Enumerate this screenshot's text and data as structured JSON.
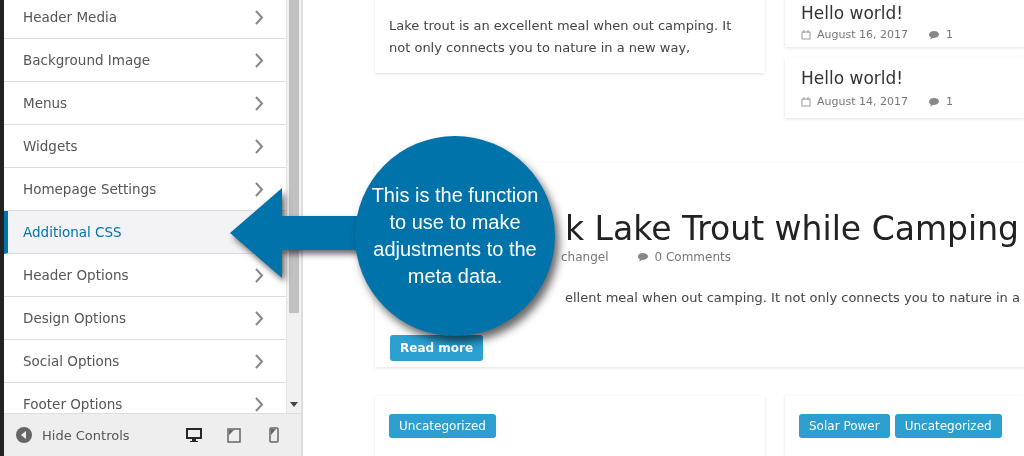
{
  "sidebar": {
    "items": [
      {
        "label": "Header Media",
        "selected": false
      },
      {
        "label": "Background Image",
        "selected": false
      },
      {
        "label": "Menus",
        "selected": false
      },
      {
        "label": "Widgets",
        "selected": false
      },
      {
        "label": "Homepage Settings",
        "selected": false
      },
      {
        "label": "Additional CSS",
        "selected": true
      },
      {
        "label": "Header Options",
        "selected": false
      },
      {
        "label": "Design Options",
        "selected": false
      },
      {
        "label": "Social Options",
        "selected": false
      },
      {
        "label": "Footer Options",
        "selected": false
      }
    ]
  },
  "footer": {
    "hide_controls": "Hide Controls",
    "devices": [
      {
        "kind": "desktop",
        "selected": true
      },
      {
        "kind": "tablet",
        "selected": false
      },
      {
        "kind": "mobile",
        "selected": false
      }
    ]
  },
  "top_post": {
    "excerpt": "Lake trout is an excellent meal when out camping. It not only connects you to nature in a new way,"
  },
  "recent_posts": [
    {
      "title": "Hello world!",
      "date": "August 16, 2017",
      "comments": "1"
    },
    {
      "title": "Hello world!",
      "date": "August 14, 2017",
      "comments": "1"
    }
  ],
  "featured_post": {
    "title": "k Lake Trout while Camping",
    "author": "changel",
    "comments": "0 Comments",
    "excerpt": "ellent meal when out camping. It not only connects you to nature in a",
    "button": "Read more"
  },
  "bottom_cards": [
    {
      "tags": [
        "Uncategorized"
      ]
    },
    {
      "tags": [
        "Solar Power",
        "Uncategorized"
      ]
    }
  ],
  "callout": {
    "text": "This is the function to use to make adjustments to the meta data."
  }
}
